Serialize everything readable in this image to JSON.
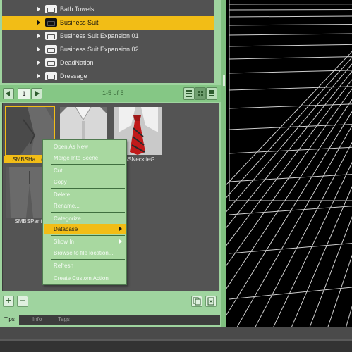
{
  "tree": {
    "items": [
      {
        "label": "Bath Towels",
        "selected": false
      },
      {
        "label": "Business Suit",
        "selected": true
      },
      {
        "label": "Business Suit Expansion 01",
        "selected": false
      },
      {
        "label": "Business Suit Expansion 02",
        "selected": false
      },
      {
        "label": "DeadNation",
        "selected": false
      },
      {
        "label": "Dressage",
        "selected": false
      }
    ]
  },
  "pager": {
    "page": "1",
    "range": "1-5 of 5"
  },
  "thumbnails": [
    {
      "label": "SMBSHa…ch",
      "icon": "jacket-thumbnail",
      "selected": true
    },
    {
      "label": "",
      "icon": "shirt-thumbnail",
      "selected": false
    },
    {
      "label": "SBSNecktieG",
      "icon": "necktie-thumbnail",
      "selected": false
    },
    {
      "label": "SMBSPants",
      "icon": "pants-thumbnail",
      "selected": false
    }
  ],
  "context_menu": {
    "items": [
      {
        "label": "Open As New"
      },
      {
        "label": "Merge Into Scene"
      },
      {
        "label": "Cut"
      },
      {
        "label": "Copy"
      },
      {
        "label": "Delete..."
      },
      {
        "label": "Rename..."
      },
      {
        "label": "Categorize..."
      },
      {
        "label": "Database",
        "highlighted": true,
        "submenu": true
      },
      {
        "label": "Show In",
        "submenu": true
      },
      {
        "label": "Browse to file location..."
      },
      {
        "label": "Refresh"
      },
      {
        "label": "Create Custom Action"
      }
    ]
  },
  "bottom": {
    "add_label": "+",
    "remove_label": "−"
  },
  "tabs": [
    {
      "label": "Tips",
      "active": true
    },
    {
      "label": "Info",
      "active": false
    },
    {
      "label": "Tags",
      "active": false
    }
  ],
  "colors": {
    "accent": "#f2bd16",
    "panel": "#9fd49f",
    "viewport": "#000000"
  }
}
